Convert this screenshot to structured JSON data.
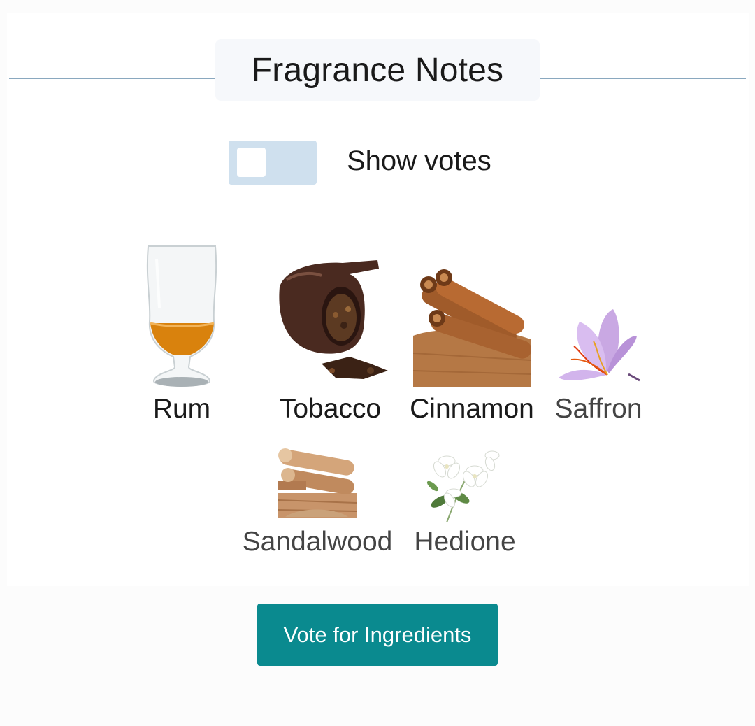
{
  "section": {
    "title": "Fragrance Notes"
  },
  "toggle": {
    "label": "Show votes",
    "checked": false
  },
  "notes": [
    {
      "name": "Rum",
      "icon": "rum-glass-icon",
      "emphasis": "strong"
    },
    {
      "name": "Tobacco",
      "icon": "tobacco-pipe-icon",
      "emphasis": "strong"
    },
    {
      "name": "Cinnamon",
      "icon": "cinnamon-sticks-icon",
      "emphasis": "strong"
    },
    {
      "name": "Saffron",
      "icon": "saffron-flower-icon",
      "emphasis": "light"
    },
    {
      "name": "Sandalwood",
      "icon": "sandalwood-icon",
      "emphasis": "light"
    },
    {
      "name": "Hedione",
      "icon": "jasmine-flower-icon",
      "emphasis": "light"
    }
  ],
  "vote_button": {
    "label": "Vote for Ingredients"
  },
  "colors": {
    "accent": "#0a8a8f",
    "toggle_track": "#cfe0ee",
    "rule": "#8aa8bf",
    "strong_text": "#1a1a1a",
    "light_text": "#444444"
  }
}
